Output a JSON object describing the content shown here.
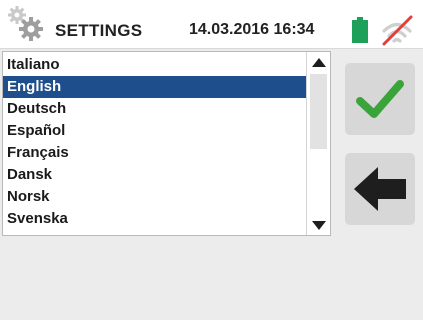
{
  "header": {
    "title": "SETTINGS",
    "datetime": "14.03.2016 16:34",
    "icons": [
      "gear-icon",
      "battery-icon",
      "no-signal-icon"
    ],
    "battery_color": "#1ea05a"
  },
  "languages": {
    "items": [
      {
        "label": "Italiano"
      },
      {
        "label": "English"
      },
      {
        "label": "Deutsch"
      },
      {
        "label": "Español"
      },
      {
        "label": "Français"
      },
      {
        "label": "Dansk"
      },
      {
        "label": "Norsk"
      },
      {
        "label": "Svenska"
      }
    ],
    "selected": "English",
    "selection_color": "#1f4e8c"
  },
  "buttons": {
    "confirm_icon": "checkmark-icon",
    "confirm_color": "#3aa33a",
    "back_icon": "arrow-left-icon",
    "back_color": "#1e1e1e"
  }
}
